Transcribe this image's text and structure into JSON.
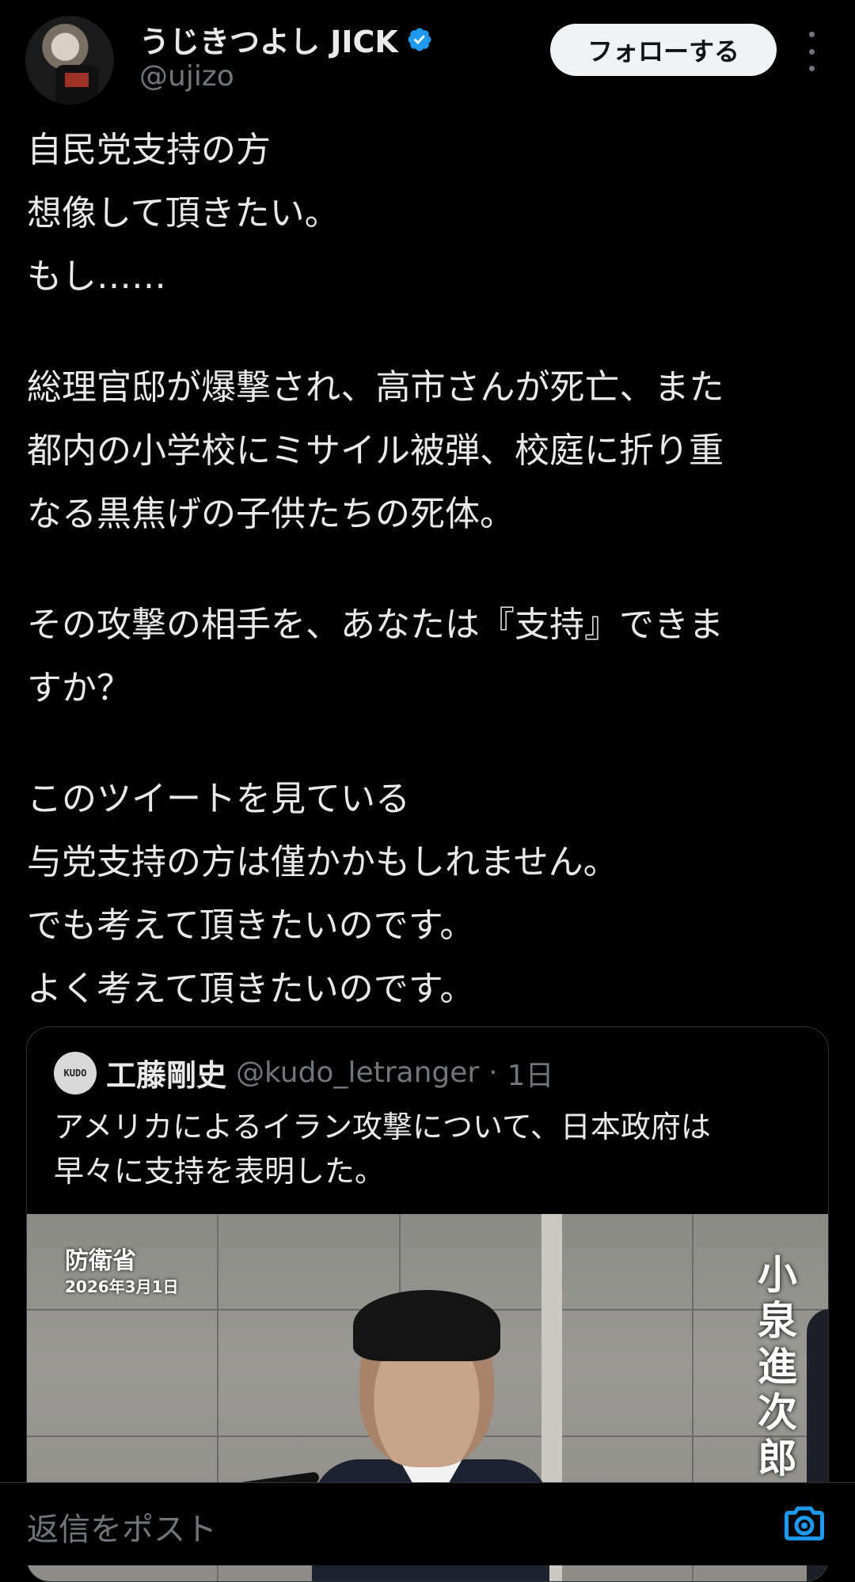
{
  "author": {
    "display_name": "うじきつよし JICK",
    "handle": "@ujizo",
    "verified": true
  },
  "follow_label": "フォローする",
  "tweet_lines": [
    "自民党支持の方",
    "想像して頂きたい。",
    "もし……",
    "",
    "総理官邸が爆撃され、高市さんが死亡、また",
    "都内の小学校にミサイル被弾、校庭に折り重",
    "なる黒焦げの子供たちの死体。",
    "",
    "その攻撃の相手を、あなたは『支持』できま",
    "すか？",
    "",
    "このツイートを見ている",
    "与党支持の方は僅かかもしれません。",
    "でも考えて頂きたいのです。",
    "よく考えて頂きたいのです。"
  ],
  "quote": {
    "avatar_text": "KUDO",
    "name": "工藤剛史",
    "handle": "@kudo_letranger",
    "separator": "·",
    "time": "1日",
    "text": "アメリカによるイラン攻撃について、日本政府は\n早々に支持を表明した。",
    "media": {
      "org": "防衛省",
      "date": "2026年3月1日",
      "vertical_name": "小泉進次郎"
    }
  },
  "reply_placeholder": "返信をポスト",
  "colors": {
    "background": "#000000",
    "text": "#e7e9ea",
    "secondary": "#71767b",
    "verified": "#1d9bf0",
    "accent": "#1d9bf0"
  },
  "icons": [
    "verified-badge-icon",
    "more-icon",
    "camera-icon"
  ]
}
